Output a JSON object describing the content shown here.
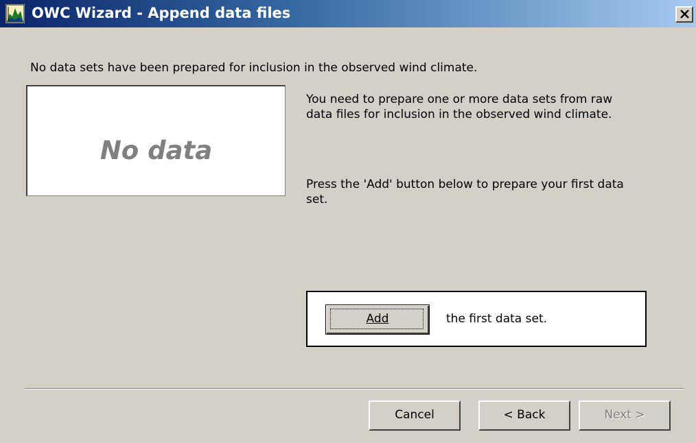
{
  "window": {
    "title": "OWC Wizard - Append data files",
    "app_icon": "owc-wizard-icon",
    "close_icon": "close-icon"
  },
  "content": {
    "headline": "No data sets have been prepared for inclusion in the observed wind climate.",
    "preview_text": "No data",
    "instruction_1": "You need to prepare one or more data sets from raw data files for inclusion in the observed wind climate.",
    "instruction_2": "Press the 'Add' button below to prepare your first data set."
  },
  "add_panel": {
    "button_label": "Add",
    "hint": "the first data set."
  },
  "footer": {
    "cancel_label": "Cancel",
    "back_label": "< Back",
    "next_label": "Next >",
    "next_enabled": false
  },
  "colors": {
    "dialog_bg": "#d4d0c8",
    "title_gradient_start": "#0a246a",
    "title_gradient_end": "#a6caf0",
    "disabled_text": "#808080"
  }
}
